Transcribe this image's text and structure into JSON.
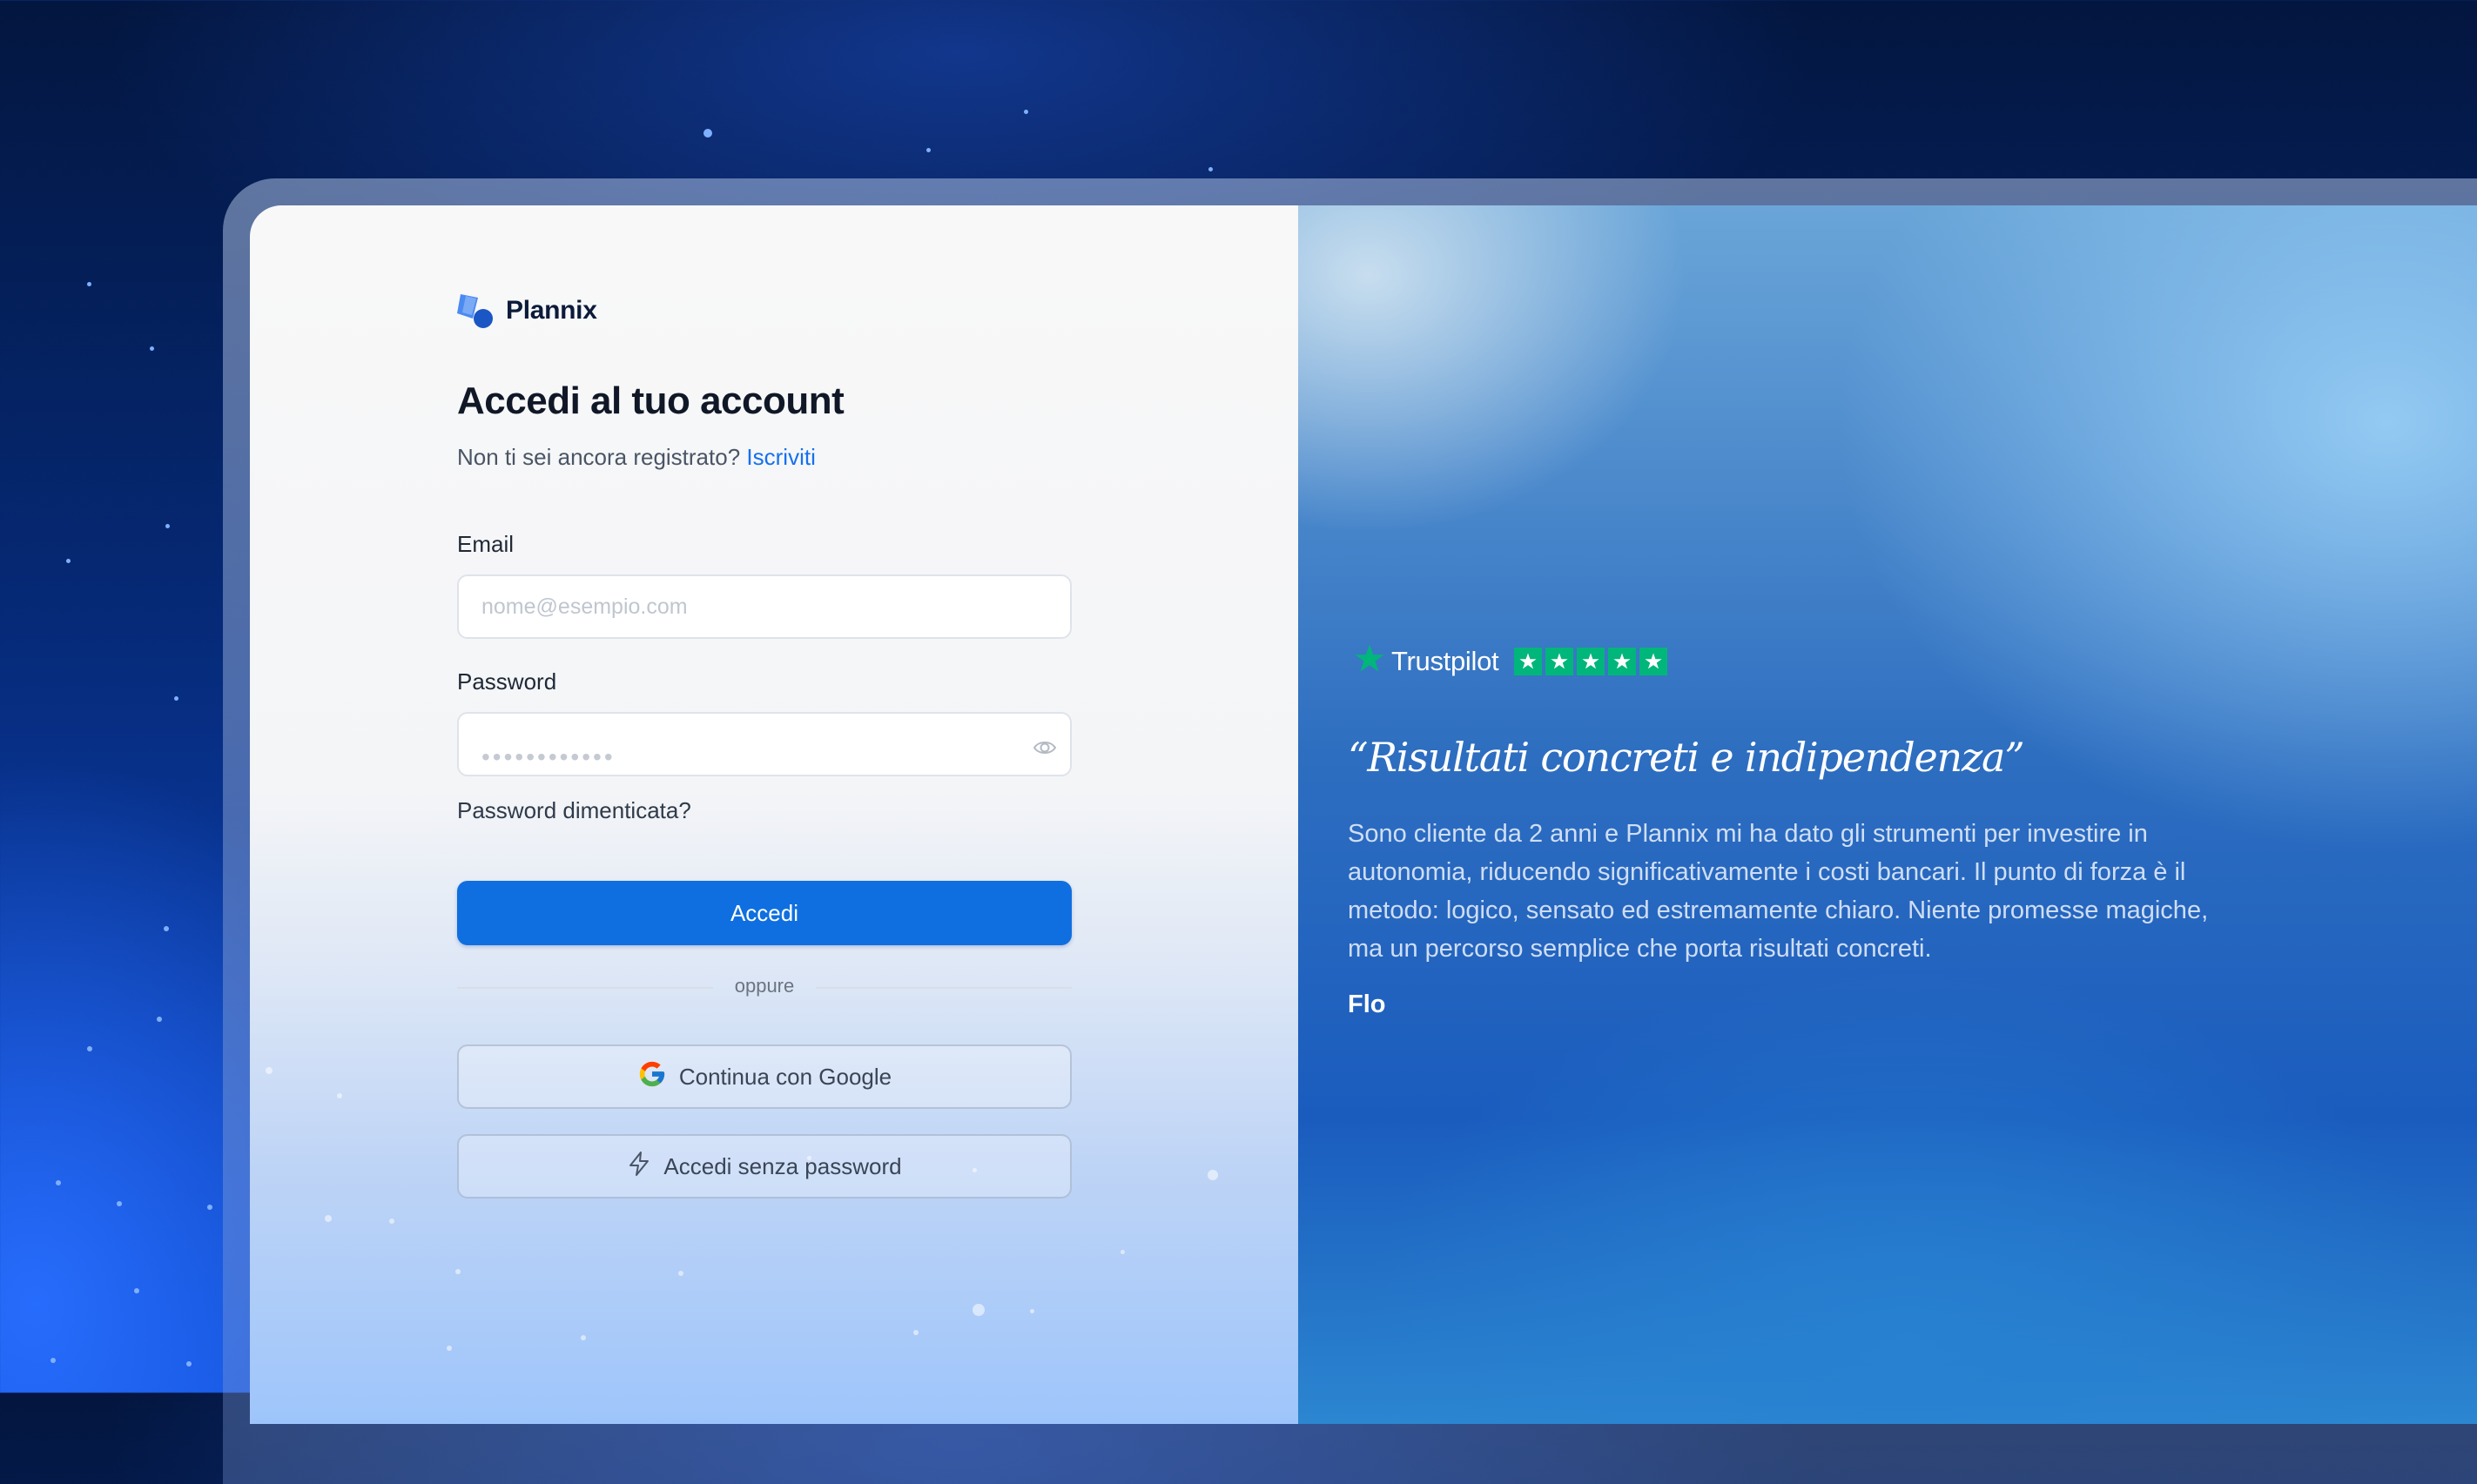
{
  "brand": {
    "name": "Plannix"
  },
  "login": {
    "title": "Accedi al tuo account",
    "signup_prompt": "Non ti sei ancora registrato?",
    "signup_link": "Iscriviti",
    "email_label": "Email",
    "email_placeholder": "nome@esempio.com",
    "password_label": "Password",
    "password_mask": "••••••••••••",
    "forgot_password": "Password dimenticata?",
    "submit_label": "Accedi",
    "divider_text": "oppure",
    "google_label": "Continua con Google",
    "passwordless_label": "Accedi senza password"
  },
  "testimonial": {
    "platform": "Trustpilot",
    "rating": 5,
    "max_rating": 5,
    "quote": "“Risultati concreti e indipendenza”",
    "text": "Sono cliente da 2 anni e Plannix mi ha dato gli strumenti per investire in autonomia, riducendo significativamente i costi bancari. Il punto di forza è il metodo: logico, sensato ed estremamente chiaro. Niente promesse magiche, ma un percorso semplice che porta risultati concreti.",
    "author": "Flo"
  },
  "colors": {
    "primary": "#0f6fe0",
    "link": "#1570ef",
    "trustpilot_green": "#00b67a"
  }
}
